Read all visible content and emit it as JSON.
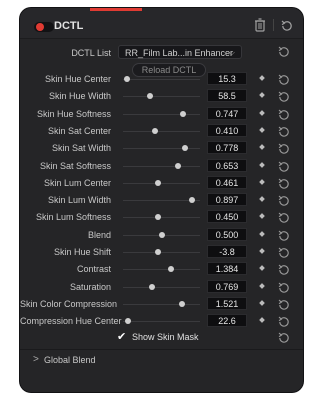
{
  "header": {
    "title": "DCTL",
    "enabled": true,
    "accent_color": "#e03b33"
  },
  "dctl_list": {
    "label": "DCTL List",
    "selected": "RR_Film Lab...in Enhancer",
    "chevron": "⌵"
  },
  "reload_button": "Reload DCTL",
  "params": [
    {
      "label": "Skin Hue Center",
      "value": "15.3",
      "level": 0.05
    },
    {
      "label": "Skin Hue Width",
      "value": "58.5",
      "level": 0.35
    },
    {
      "label": "Skin Hue Softness",
      "value": "0.747",
      "level": 0.78
    },
    {
      "label": "Skin Sat Center",
      "value": "0.410",
      "level": 0.41
    },
    {
      "label": "Skin Sat Width",
      "value": "0.778",
      "level": 0.81
    },
    {
      "label": "Skin Sat Softness",
      "value": "0.653",
      "level": 0.72
    },
    {
      "label": "Skin Lum Center",
      "value": "0.461",
      "level": 0.46
    },
    {
      "label": "Skin Lum Width",
      "value": "0.897",
      "level": 0.9
    },
    {
      "label": "Skin Lum Softness",
      "value": "0.450",
      "level": 0.45
    },
    {
      "label": "Blend",
      "value": "0.500",
      "level": 0.5
    },
    {
      "label": "Skin Hue Shift",
      "value": "-3.8",
      "level": 0.46
    },
    {
      "label": "Contrast",
      "value": "1.384",
      "level": 0.62
    },
    {
      "label": "Saturation",
      "value": "0.769",
      "level": 0.38
    },
    {
      "label": "Skin Color Compression",
      "value": "1.521",
      "level": 0.76
    },
    {
      "label": "Compression Hue Center",
      "value": "22.6",
      "level": 0.06
    }
  ],
  "show_skin_mask": {
    "label": "Show Skin Mask",
    "checked": true,
    "check_glyph": "✔"
  },
  "global_blend": {
    "label": "Global Blend",
    "chevron": ">"
  },
  "icons": {
    "trash": "trash-icon",
    "reset": "reset-icon",
    "keyframe": "keyframe-diamond-icon"
  }
}
